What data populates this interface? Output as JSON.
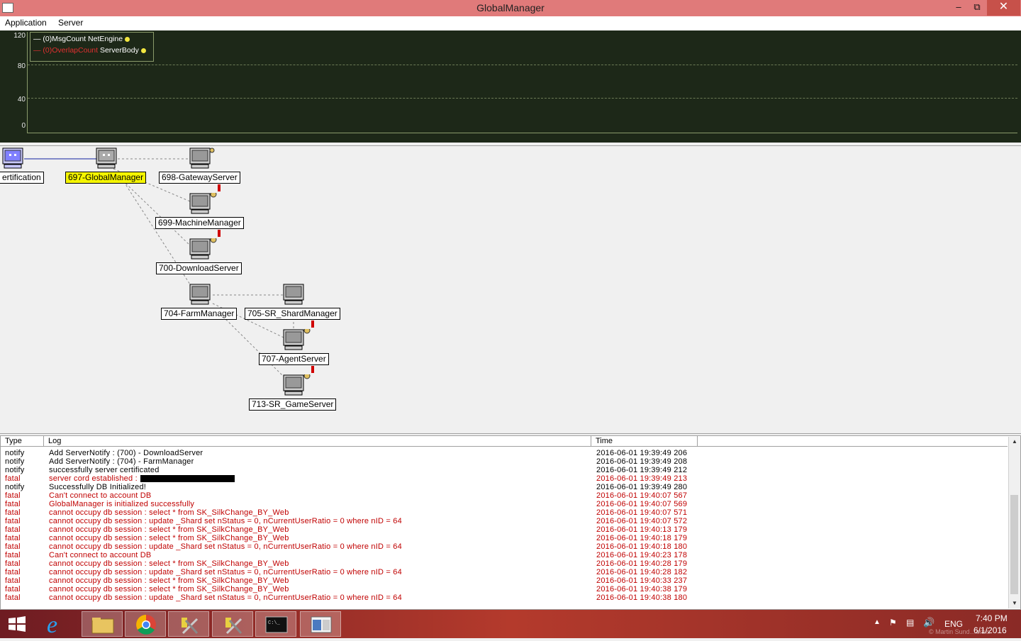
{
  "window": {
    "title": "GlobalManager",
    "min_glyph": "–",
    "restore_glyph": "⧉",
    "close_glyph": "✕"
  },
  "menu": [
    "Application",
    "Server"
  ],
  "graph": {
    "y_ticks": [
      "120",
      "80",
      "40",
      "0"
    ],
    "legend": [
      {
        "prefix": "— (0)MsgCount",
        "name": "NetEngine",
        "prefix_color": "#ffffff"
      },
      {
        "prefix": "— (0)OverlapCount",
        "name": "ServerBody",
        "prefix_color": "#e03030"
      }
    ]
  },
  "topology": {
    "nodes": [
      {
        "id": "cert",
        "label": "ertification",
        "selected": false
      },
      {
        "id": "gm",
        "label": "697-GlobalManager",
        "selected": true
      },
      {
        "id": "gw",
        "label": "698-GatewayServer",
        "selected": false
      },
      {
        "id": "mm",
        "label": "699-MachineManager",
        "selected": false
      },
      {
        "id": "ds",
        "label": "700-DownloadServer",
        "selected": false
      },
      {
        "id": "fm",
        "label": "704-FarmManager",
        "selected": false
      },
      {
        "id": "sm",
        "label": "705-SR_ShardManager",
        "selected": false
      },
      {
        "id": "as",
        "label": "707-AgentServer",
        "selected": false
      },
      {
        "id": "gs",
        "label": "713-SR_GameServer",
        "selected": false
      }
    ]
  },
  "log": {
    "columns": [
      "Type",
      "Log",
      "Time"
    ],
    "rows": [
      {
        "type": "notify",
        "msg": "Add ServerNotify : (700) - DownloadServer",
        "time": "2016-06-01 19:39:49 206"
      },
      {
        "type": "notify",
        "msg": "Add ServerNotify : (704) - FarmManager",
        "time": "2016-06-01 19:39:49 208"
      },
      {
        "type": "notify",
        "msg": "successfully server certificated",
        "time": "2016-06-01 19:39:49 212"
      },
      {
        "type": "fatal",
        "msg": "server cord established :",
        "time": "2016-06-01 19:39:49 213",
        "redacted": true
      },
      {
        "type": "notify",
        "msg": "Successfully DB Initialized!",
        "time": "2016-06-01 19:39:49 280"
      },
      {
        "type": "fatal",
        "msg": "Can't connect to account DB",
        "time": "2016-06-01 19:40:07 567"
      },
      {
        "type": "fatal",
        "msg": "GlobalManager is initialized successfully",
        "time": "2016-06-01 19:40:07 569"
      },
      {
        "type": "fatal",
        "msg": "cannot occupy db session : select * from SK_SilkChange_BY_Web",
        "time": "2016-06-01 19:40:07 571"
      },
      {
        "type": "fatal",
        "msg": "cannot occupy db session : update _Shard set nStatus = 0, nCurrentUserRatio = 0 where nID = 64",
        "time": "2016-06-01 19:40:07 572"
      },
      {
        "type": "fatal",
        "msg": "cannot occupy db session : select * from SK_SilkChange_BY_Web",
        "time": "2016-06-01 19:40:13 179"
      },
      {
        "type": "fatal",
        "msg": "cannot occupy db session : select * from SK_SilkChange_BY_Web",
        "time": "2016-06-01 19:40:18 179"
      },
      {
        "type": "fatal",
        "msg": "cannot occupy db session : update _Shard set nStatus = 0, nCurrentUserRatio = 0 where nID = 64",
        "time": "2016-06-01 19:40:18 180"
      },
      {
        "type": "fatal",
        "msg": "Can't connect to account DB",
        "time": "2016-06-01 19:40:23 178"
      },
      {
        "type": "fatal",
        "msg": "cannot occupy db session : select * from SK_SilkChange_BY_Web",
        "time": "2016-06-01 19:40:28 179"
      },
      {
        "type": "fatal",
        "msg": "cannot occupy db session : update _Shard set nStatus = 0, nCurrentUserRatio = 0 where nID = 64",
        "time": "2016-06-01 19:40:28 182"
      },
      {
        "type": "fatal",
        "msg": "cannot occupy db session : select * from SK_SilkChange_BY_Web",
        "time": "2016-06-01 19:40:33 237"
      },
      {
        "type": "fatal",
        "msg": "cannot occupy db session : select * from SK_SilkChange_BY_Web",
        "time": "2016-06-01 19:40:38 179"
      },
      {
        "type": "fatal",
        "msg": "cannot occupy db session : update _Shard set nStatus = 0, nCurrentUserRatio = 0 where nID = 64",
        "time": "2016-06-01 19:40:38 180"
      }
    ]
  },
  "taskbar": {
    "apps": [
      "start-icon",
      "internet-explorer-icon",
      "file-explorer-icon",
      "chrome-icon",
      "tools-icon",
      "tools-icon",
      "cmd-icon",
      "app-window-icon"
    ],
    "lang": "ENG",
    "time": "7:40 PM",
    "date": "6/1/2016",
    "watermark": "© Martin Sund…orbis"
  },
  "colors": {
    "fatal": "#c00000",
    "notify": "#000000",
    "graph_bg": "#1d2818",
    "selected_label": "#f5f500"
  }
}
